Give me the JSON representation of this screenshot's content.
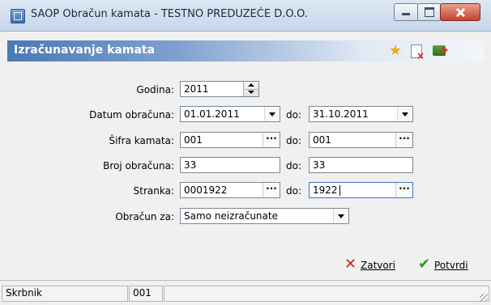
{
  "window": {
    "title": "SAOP Obračun kamata - TESTNO PREDUZEĆE D.O.O.",
    "app_icon": "saop-app-icon"
  },
  "header": {
    "title": "Izračunavanje kamata",
    "icons": [
      "star-icon",
      "document-delete-icon",
      "export-icon"
    ]
  },
  "form": {
    "godina": {
      "label": "Godina:",
      "value": "2011"
    },
    "datum_obracuna": {
      "label": "Datum obračuna:",
      "from": "01.01.2011",
      "to": "31.10.2011"
    },
    "sifra_kamata": {
      "label": "Šifra kamata:",
      "from": "001",
      "to": "001"
    },
    "broj_obracuna": {
      "label": "Broj obračuna:",
      "from": "33",
      "to": "33"
    },
    "stranka": {
      "label": "Stranka:",
      "from": "0001922",
      "to": "1922"
    },
    "obracun_za": {
      "label": "Obračun za:",
      "value": "Samo neizračunate"
    },
    "do_label": "do:",
    "lookup_glyph": "···"
  },
  "buttons": {
    "zatvori": "Zatvori",
    "potvrdi": "Potvrdi"
  },
  "status": {
    "user": "Skrbnik",
    "code": "001"
  },
  "colors": {
    "header_blue": "#4a79b5",
    "close_red": "#c4412a",
    "confirm_green": "#2d9a1e"
  }
}
